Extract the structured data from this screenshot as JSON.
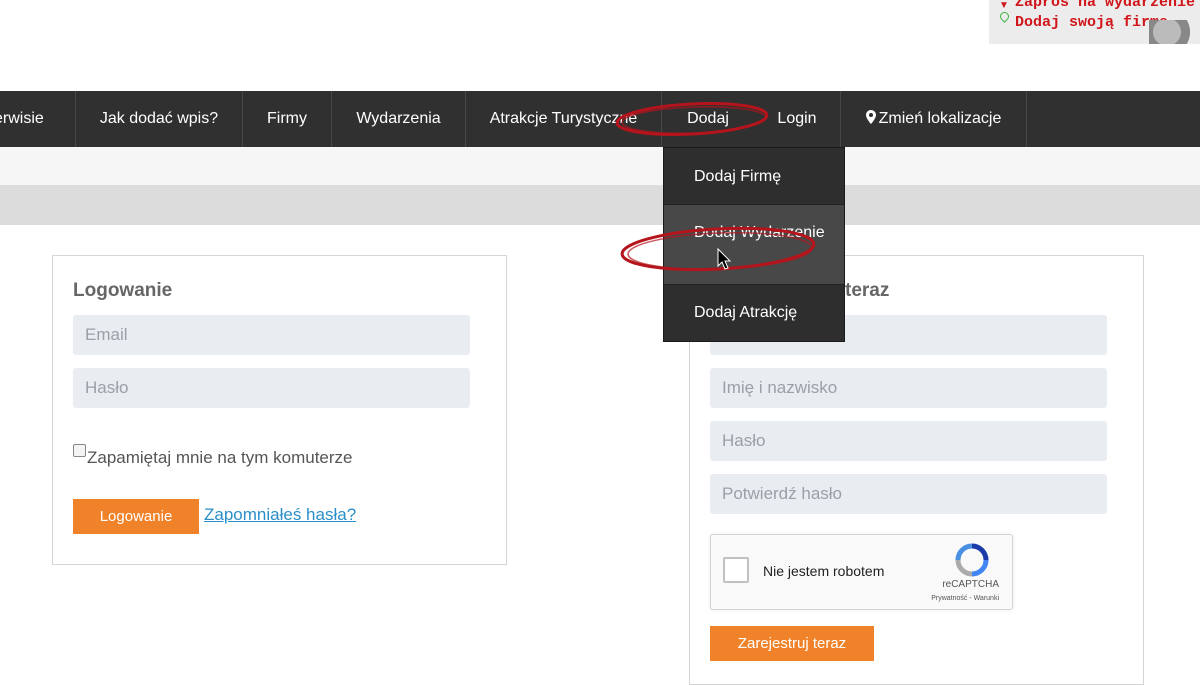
{
  "promo": {
    "line1": "Zaproś na wydarzenie",
    "line2": "Dodaj swoją firmę"
  },
  "nav": {
    "items": [
      {
        "label": "erwisie"
      },
      {
        "label": "Jak dodać wpis?"
      },
      {
        "label": "Firmy"
      },
      {
        "label": "Wydarzenia"
      },
      {
        "label": "Atrakcje Turystyczne"
      },
      {
        "label": "Dodaj"
      },
      {
        "label": "Login"
      },
      {
        "label": "Zmień lokalizacje"
      }
    ]
  },
  "dropdown": {
    "items": [
      {
        "label": "Dodaj Firmę"
      },
      {
        "label": "Dodaj Wydarzenie"
      },
      {
        "label": "Dodaj Atrakcję"
      }
    ]
  },
  "login": {
    "title": "Logowanie",
    "email_placeholder": "Email",
    "password_placeholder": "Hasło",
    "remember_label": "Zapamiętaj mnie na tym komuterze",
    "submit_label": "Logowanie",
    "forgot_label": "Zapomniałeś hasła?"
  },
  "register": {
    "title_visible": "teraz",
    "name_placeholder": "Imię i nazwisko",
    "password_placeholder": "Hasło",
    "confirm_placeholder": "Potwierdź hasło",
    "submit_label": "Zarejestruj teraz"
  },
  "recaptcha": {
    "label": "Nie jestem robotem",
    "brand": "reCAPTCHA",
    "links": "Prywatność - Warunki"
  },
  "colors": {
    "nav_bg": "#303030",
    "accent_orange": "#f0822a",
    "annotation_red": "#b5141c",
    "link_blue": "#2a8fc9"
  }
}
